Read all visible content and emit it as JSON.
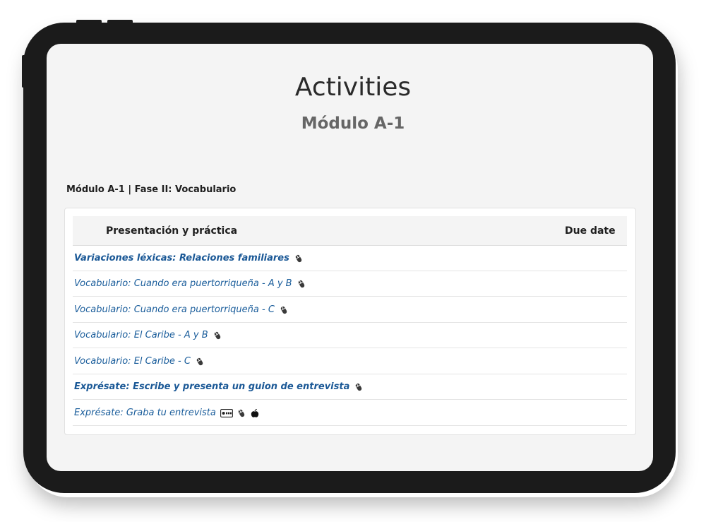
{
  "page": {
    "title": "Activities",
    "subtitle": "Módulo A-1",
    "section_label": "Módulo A-1 | Fase II: Vocabulario"
  },
  "table": {
    "columns": [
      "Presentación y práctica",
      "Due date"
    ],
    "rows": [
      {
        "label": "Variaciones léxicas: Relaciones familiares",
        "bold": true,
        "icons": [
          "mouse-icon"
        ],
        "due": ""
      },
      {
        "label": "Vocabulario: Cuando era puertorriqueña - A y B",
        "bold": false,
        "icons": [
          "mouse-icon"
        ],
        "due": ""
      },
      {
        "label": "Vocabulario: Cuando era puertorriqueña - C",
        "bold": false,
        "icons": [
          "mouse-icon"
        ],
        "due": ""
      },
      {
        "label": "Vocabulario: El Caribe - A y B",
        "bold": false,
        "icons": [
          "mouse-icon"
        ],
        "due": ""
      },
      {
        "label": "Vocabulario: El Caribe - C",
        "bold": false,
        "icons": [
          "mouse-icon"
        ],
        "due": ""
      },
      {
        "label": "Exprésate: Escribe y presenta un guion de entrevista",
        "bold": true,
        "icons": [
          "mouse-icon"
        ],
        "due": ""
      },
      {
        "label": "Exprésate: Graba tu entrevista",
        "bold": false,
        "icons": [
          "record-icon",
          "mouse-icon",
          "apple-icon"
        ],
        "due": ""
      }
    ]
  },
  "colors": {
    "link": "#1a5d9b",
    "frame": "#1b1b1b",
    "screen_bg": "#f4f4f4"
  }
}
